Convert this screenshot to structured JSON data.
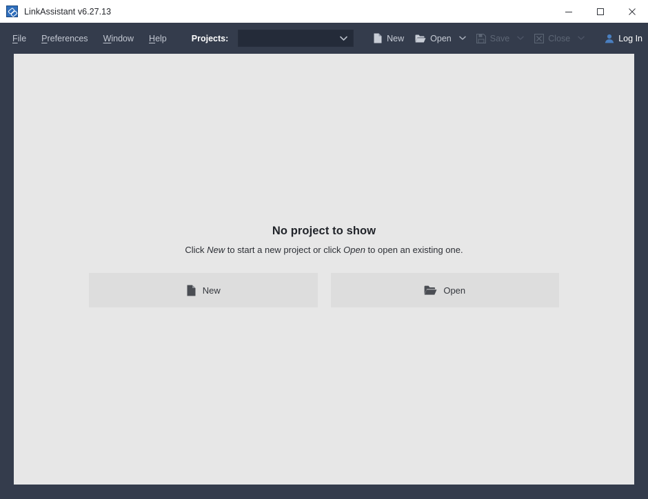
{
  "window": {
    "title": "LinkAssistant v6.27.13",
    "app_icon": "link-assistant-icon",
    "controls": {
      "minimize": "minimize-icon",
      "maximize": "maximize-icon",
      "close": "close-icon"
    }
  },
  "menu": {
    "items": [
      {
        "mnemonic": "F",
        "rest": "ile"
      },
      {
        "mnemonic": "P",
        "rest": "references"
      },
      {
        "mnemonic": "W",
        "rest": "indow"
      },
      {
        "mnemonic": "H",
        "rest": "elp"
      }
    ]
  },
  "projects": {
    "label": "Projects:",
    "selected": "",
    "placeholder": "",
    "caret_icon": "chevron-down-icon"
  },
  "toolbar": {
    "new_label": "New",
    "open_label": "Open",
    "save_label": "Save",
    "close_label": "Close",
    "login_label": "Log In",
    "new_icon": "new-document-icon",
    "open_icon": "open-folder-icon",
    "save_icon": "floppy-disk-icon",
    "close_icon": "close-project-icon",
    "login_icon": "user-icon",
    "caret_icon": "chevron-down-icon"
  },
  "main": {
    "empty_title": "No project to show",
    "empty_sub_1": "Click ",
    "empty_sub_em_1": "New",
    "empty_sub_2": " to start a new project or click ",
    "empty_sub_em_2": "Open",
    "empty_sub_3": " to open an existing one.",
    "new_button_label": "New",
    "open_button_label": "Open"
  },
  "colors": {
    "chrome": "#343c4c",
    "chrome_dark": "#242b39",
    "content_bg": "#e7e7e7",
    "button_bg": "#dddddd",
    "accent_blue": "#4a7fc0",
    "disabled_text": "#5d6675"
  }
}
